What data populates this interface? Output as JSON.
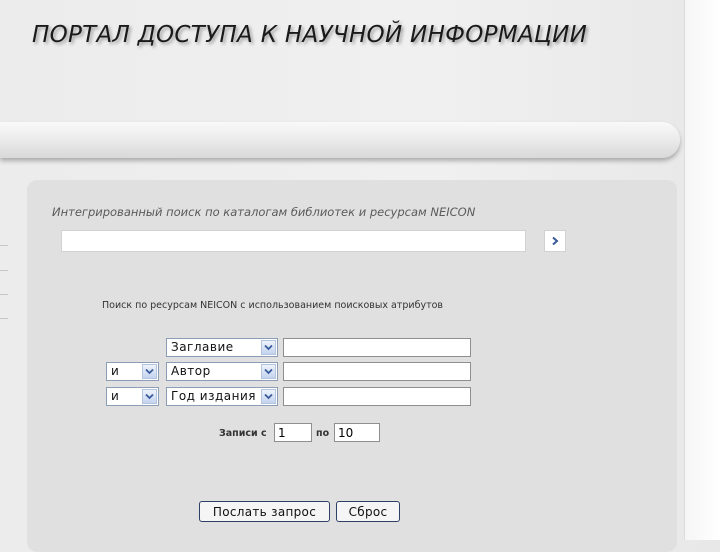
{
  "header": {
    "title": "ПОРТАЛ ДОСТУПА К НАУЧНОЙ ИНФОРМАЦИИ"
  },
  "search": {
    "heading": "Интегрированный поиск по каталогам библиотек и ресурсам NEICON",
    "query": "",
    "go_icon": "chevron-right-icon"
  },
  "advanced": {
    "heading": "Поиск по ресурсам NEICON с использованием поисковых атрибутов",
    "rows": [
      {
        "operator": "",
        "field": "Заглавие",
        "value": ""
      },
      {
        "operator": "и",
        "field": "Автор",
        "value": ""
      },
      {
        "operator": "и",
        "field": "Год издания",
        "value": ""
      }
    ],
    "records_label": "Записи с",
    "records_to_label": "по",
    "records_from": "1",
    "records_to": "10"
  },
  "buttons": {
    "submit": "Послать запрос",
    "reset": "Сброс"
  },
  "colors": {
    "panel": "#e0e0e0",
    "select_border": "#8c9db8",
    "button_border": "#2e3f66",
    "arrow_color": "#3a5a9a"
  }
}
